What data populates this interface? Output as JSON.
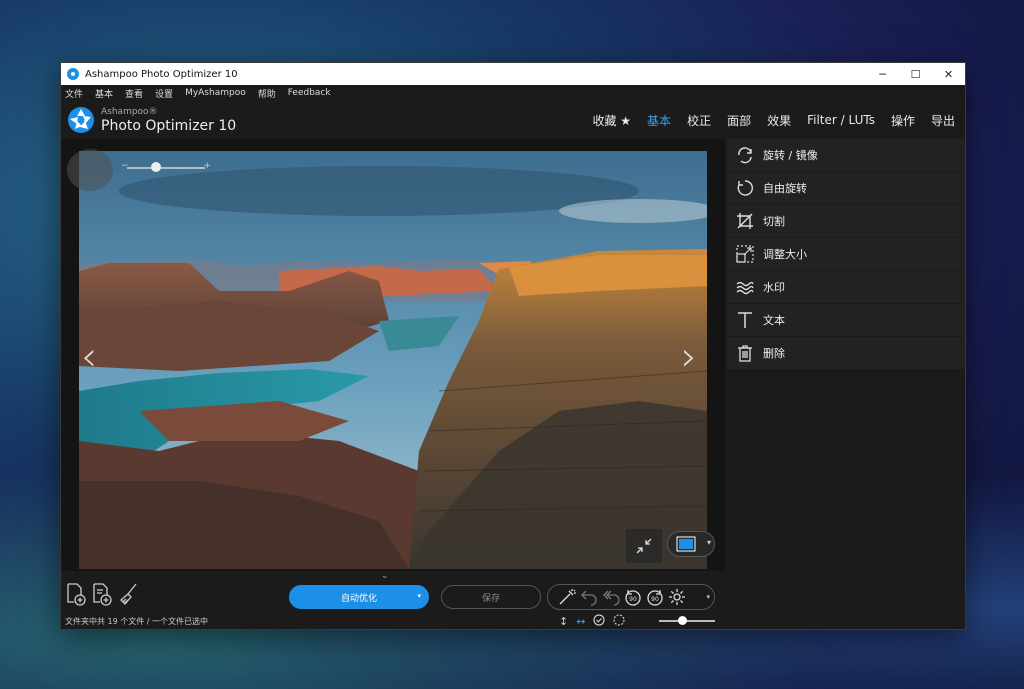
{
  "window": {
    "title": "Ashampoo Photo Optimizer 10",
    "controls": {
      "minimize": "─",
      "maximize": "☐",
      "close": "✕"
    }
  },
  "menu": [
    "文件",
    "基本",
    "查看",
    "设置",
    "MyAshampoo",
    "帮助",
    "Feedback"
  ],
  "logo": {
    "brand": "Ashampoo®",
    "product": "Photo Optimizer 10"
  },
  "tabs": [
    {
      "label": "收藏 ★",
      "active": false
    },
    {
      "label": "基本",
      "active": true
    },
    {
      "label": "校正",
      "active": false
    },
    {
      "label": "面部",
      "active": false
    },
    {
      "label": "效果",
      "active": false
    },
    {
      "label": "Filter / LUTs",
      "active": false
    },
    {
      "label": "操作",
      "active": false
    },
    {
      "label": "导出",
      "active": false
    }
  ],
  "tools": [
    {
      "label": "旋转 / 镜像",
      "icon": "rotate-mirror-icon"
    },
    {
      "label": "自由旋转",
      "icon": "free-rotate-icon"
    },
    {
      "label": "切割",
      "icon": "crop-icon"
    },
    {
      "label": "调整大小",
      "icon": "resize-icon"
    },
    {
      "label": "水印",
      "icon": "watermark-icon"
    },
    {
      "label": "文本",
      "icon": "text-icon"
    },
    {
      "label": "删除",
      "icon": "trash-icon"
    }
  ],
  "viewer": {
    "nav_left": "‹",
    "nav_right": "›",
    "zoom_minus": "−",
    "zoom_plus": "+",
    "zoom_level": 0.35
  },
  "toolbar": {
    "auto_optimize": "自动优化",
    "save": "保存",
    "dropdown": "▾",
    "collapse": "⌄"
  },
  "status": {
    "text": "文件夹中共 19 个文件 / 一个文件已选中",
    "thumb_size": 0.4
  },
  "colors": {
    "accent": "#1c8fe6",
    "active_tab": "#2fa4ff",
    "background": "#1b1b1b",
    "panel": "#222222"
  }
}
